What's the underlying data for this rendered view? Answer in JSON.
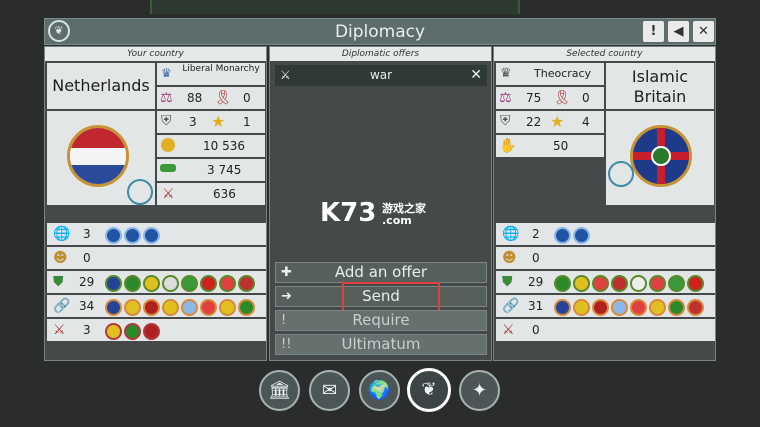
{
  "window": {
    "title": "Diplomacy"
  },
  "headers": {
    "your_country": "Your country",
    "offers": "Diplomatic offers",
    "selected": "Selected country"
  },
  "your_country": {
    "name": "Netherlands",
    "government": "Liberal Monarchy",
    "stats": {
      "stability": "88",
      "rebellion": "0",
      "defense": "3",
      "stars": "1",
      "coins": "10 536",
      "money": "3 745",
      "military": "636"
    },
    "rows": {
      "alliances": "3",
      "masks": "0",
      "shields": "29",
      "links": "34",
      "war": "3"
    }
  },
  "selected_country": {
    "name_line1": "Islamic",
    "name_line2": "Britain",
    "government": "Theocracy",
    "stats": {
      "stability": "75",
      "rebellion": "0",
      "defense": "22",
      "stars": "4",
      "handshake": "50"
    },
    "rows": {
      "alliances": "2",
      "masks": "0",
      "shields": "29",
      "links": "31",
      "war": "0"
    }
  },
  "offers": {
    "current": "war",
    "buttons": {
      "add": "Add an offer",
      "send": "Send",
      "require": "Require",
      "ultimatum": "Ultimatum"
    }
  },
  "watermark": {
    "brand": "K73",
    "sub": "游戏之家",
    "domain": ".com"
  },
  "nav": [
    "bank-icon",
    "mail-icon",
    "globe-icon",
    "emblem-icon",
    "compass-icon"
  ]
}
